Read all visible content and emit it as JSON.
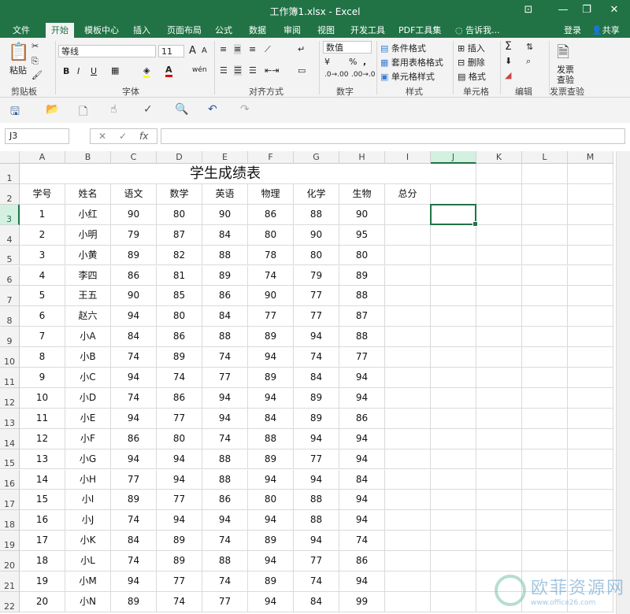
{
  "window": {
    "title": "工作簿1.xlsx - Excel",
    "min": "—",
    "restore": "❐",
    "close": "✕",
    "pin": "⊡"
  },
  "menu": {
    "tabs": [
      "文件",
      "开始",
      "模板中心",
      "插入",
      "页面布局",
      "公式",
      "数据",
      "审阅",
      "视图",
      "开发工具",
      "PDF工具集"
    ],
    "active_index": 1,
    "search": "告诉我...",
    "login": "登录",
    "share": "共享"
  },
  "ribbon": {
    "clipboard": {
      "paste": "粘贴",
      "label": "剪贴板"
    },
    "font": {
      "name": "等线",
      "size": "11",
      "bold": "B",
      "italic": "I",
      "underline": "U",
      "label": "字体",
      "grow": "A",
      "shrink": "A",
      "wen": "wén"
    },
    "align": {
      "label": "对齐方式"
    },
    "number": {
      "format": "数值",
      "label": "数字",
      "percent": "%",
      "comma": ","
    },
    "styles": {
      "cond": "条件格式",
      "table": "套用表格格式",
      "cell": "单元格样式",
      "label": "样式"
    },
    "cells": {
      "insert": "插入",
      "delete": "删除",
      "format": "格式",
      "label": "单元格"
    },
    "editing": {
      "label": "编辑"
    },
    "invoice": {
      "line1": "发票",
      "line2": "查验",
      "label": "发票查验"
    }
  },
  "formula_bar": {
    "name_box": "J3",
    "fx": "fx",
    "content": ""
  },
  "sheet": {
    "columns": [
      "A",
      "B",
      "C",
      "D",
      "E",
      "F",
      "G",
      "H",
      "I",
      "J",
      "K",
      "L",
      "M"
    ],
    "selected_column": "J",
    "selected_row": 3,
    "title": "学生成绩表",
    "headers": [
      "学号",
      "姓名",
      "语文",
      "数学",
      "英语",
      "物理",
      "化学",
      "生物",
      "总分"
    ],
    "rows": [
      [
        "1",
        "小红",
        "90",
        "80",
        "90",
        "86",
        "88",
        "90"
      ],
      [
        "2",
        "小明",
        "79",
        "87",
        "84",
        "80",
        "90",
        "95"
      ],
      [
        "3",
        "小黄",
        "89",
        "82",
        "88",
        "78",
        "80",
        "80"
      ],
      [
        "4",
        "李四",
        "86",
        "81",
        "89",
        "74",
        "79",
        "89"
      ],
      [
        "5",
        "王五",
        "90",
        "85",
        "86",
        "90",
        "77",
        "88"
      ],
      [
        "6",
        "赵六",
        "94",
        "80",
        "84",
        "77",
        "77",
        "87"
      ],
      [
        "7",
        "小A",
        "84",
        "86",
        "88",
        "89",
        "94",
        "88"
      ],
      [
        "8",
        "小B",
        "74",
        "89",
        "74",
        "94",
        "74",
        "77"
      ],
      [
        "9",
        "小C",
        "94",
        "74",
        "77",
        "89",
        "84",
        "94"
      ],
      [
        "10",
        "小D",
        "74",
        "86",
        "94",
        "94",
        "89",
        "94"
      ],
      [
        "11",
        "小E",
        "94",
        "77",
        "94",
        "84",
        "89",
        "86"
      ],
      [
        "12",
        "小F",
        "86",
        "80",
        "74",
        "88",
        "94",
        "94"
      ],
      [
        "13",
        "小G",
        "94",
        "94",
        "88",
        "89",
        "77",
        "94"
      ],
      [
        "14",
        "小H",
        "77",
        "94",
        "88",
        "94",
        "94",
        "84"
      ],
      [
        "15",
        "小I",
        "89",
        "77",
        "86",
        "80",
        "88",
        "94"
      ],
      [
        "16",
        "小J",
        "74",
        "94",
        "94",
        "94",
        "88",
        "94"
      ],
      [
        "17",
        "小K",
        "84",
        "89",
        "74",
        "89",
        "94",
        "74"
      ],
      [
        "18",
        "小L",
        "74",
        "89",
        "88",
        "94",
        "77",
        "86"
      ],
      [
        "19",
        "小M",
        "94",
        "77",
        "74",
        "89",
        "74",
        "94"
      ],
      [
        "20",
        "小N",
        "89",
        "74",
        "77",
        "94",
        "84",
        "99"
      ]
    ]
  },
  "watermark": {
    "text": "欧菲资源网",
    "url": "www.office26.com"
  },
  "colors": {
    "accent": "#217346"
  }
}
